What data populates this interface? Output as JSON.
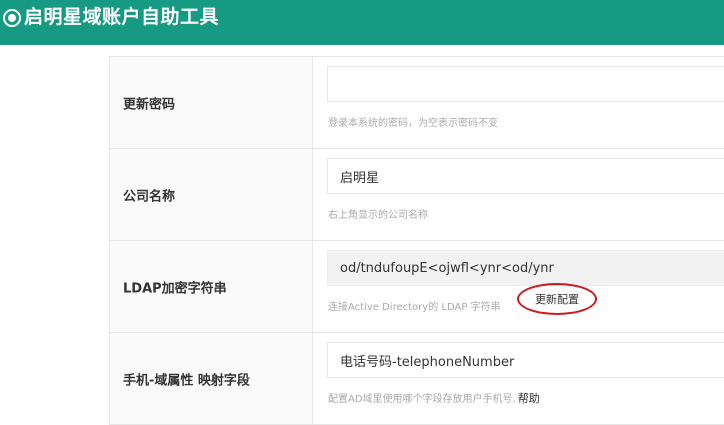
{
  "app": {
    "title": "启明星域账户自助工具"
  },
  "form": {
    "rows": [
      {
        "label": "更新密码",
        "value": "",
        "placeholder": "",
        "help": "登录本系统的密码，为空表示密码不变"
      },
      {
        "label": "公司名称",
        "value": "启明星",
        "help": "右上角显示的公司名称"
      },
      {
        "label": "LDAP加密字符串",
        "value": "od/tndufoupE<ojwfl<ynr<od/ynr",
        "help": "连接Active Directory的 LDAP 字符串",
        "action_label": "更新配置"
      },
      {
        "label": "手机-域属性 映射字段",
        "value": "电话号码-telephoneNumber",
        "help": "配置AD域里使用哪个字段存放用户手机号,",
        "help_link": "帮助"
      }
    ]
  },
  "colors": {
    "topbar": "#169b82",
    "annotation": "#d0181f"
  }
}
